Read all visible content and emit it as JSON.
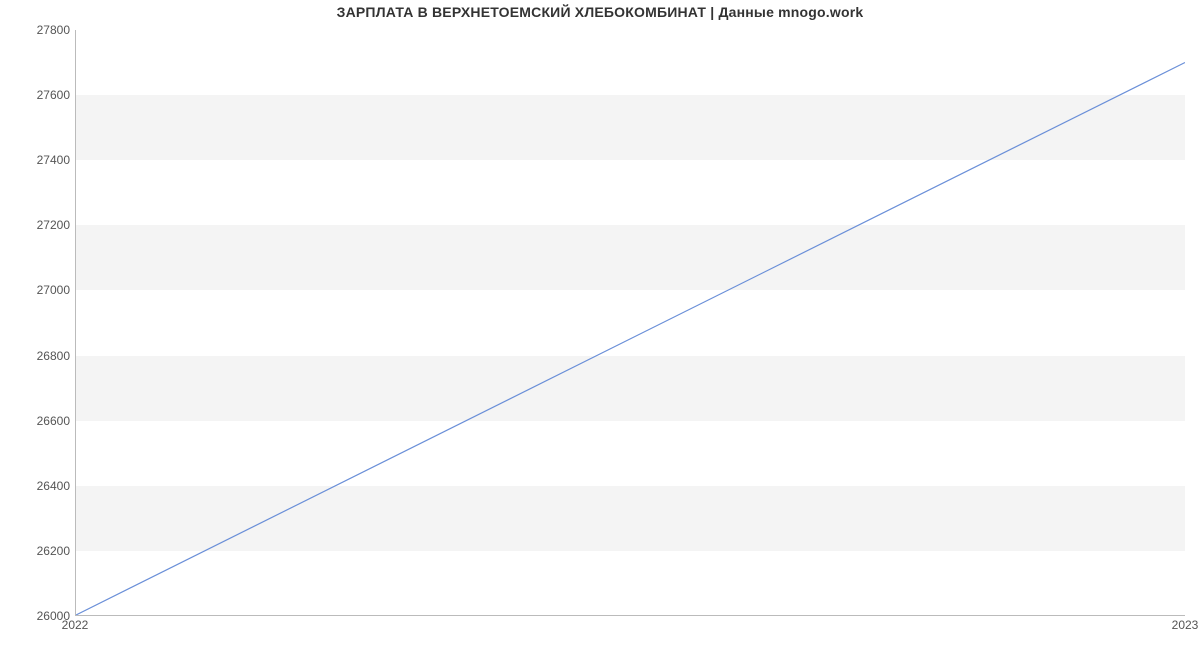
{
  "chart_data": {
    "type": "line",
    "title": "ЗАРПЛАТА В  ВЕРХНЕТОЕМСКИЙ ХЛЕБОКОМБИНАТ | Данные mnogo.work",
    "x": [
      2022,
      2023
    ],
    "values": [
      26000,
      27700
    ],
    "x_ticks": [
      "2022",
      "2023"
    ],
    "y_ticks": [
      "26000",
      "26200",
      "26400",
      "26600",
      "26800",
      "27000",
      "27200",
      "27400",
      "27600",
      "27800"
    ],
    "ylim": [
      26000,
      27800
    ],
    "xlabel": "",
    "ylabel": "",
    "line_color": "#6a8fd8",
    "band_color": "#f4f4f4"
  }
}
